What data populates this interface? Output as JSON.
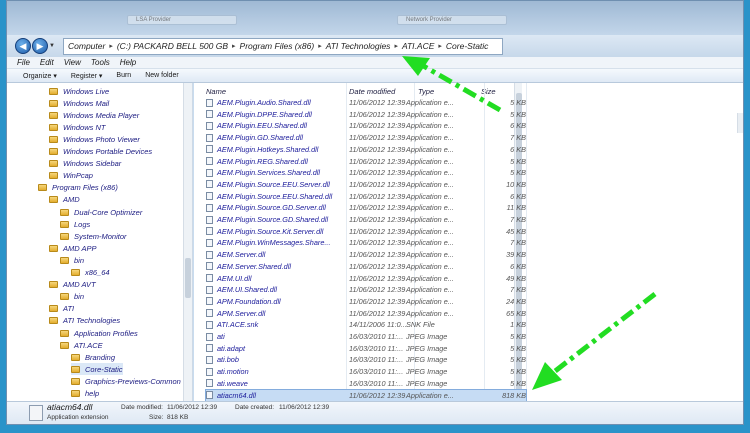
{
  "browser": {
    "tabs": [
      "LSA Provider",
      "Network Provider"
    ]
  },
  "address": {
    "crumbs": [
      "Computer",
      "(C:) PACKARD BELL 500 GB",
      "Program Files (x86)",
      "ATI Technologies",
      "ATI.ACE",
      "Core-Static"
    ]
  },
  "menu": [
    "File",
    "Edit",
    "View",
    "Tools",
    "Help"
  ],
  "toolbar": {
    "organize": "Organize ▾",
    "register": "Register ▾",
    "burn": "Burn",
    "new_folder": "New folder"
  },
  "tree": [
    {
      "label": "Windows Live",
      "indent": 2
    },
    {
      "label": "Windows Mail",
      "indent": 2
    },
    {
      "label": "Windows Media Player",
      "indent": 2
    },
    {
      "label": "Windows NT",
      "indent": 2
    },
    {
      "label": "Windows Photo Viewer",
      "indent": 2
    },
    {
      "label": "Windows Portable Devices",
      "indent": 2
    },
    {
      "label": "Windows Sidebar",
      "indent": 2
    },
    {
      "label": "WinPcap",
      "indent": 2
    },
    {
      "label": "Program Files (x86)",
      "indent": 1
    },
    {
      "label": "AMD",
      "indent": 2
    },
    {
      "label": "Dual-Core Optimizer",
      "indent": 3
    },
    {
      "label": "Logs",
      "indent": 3
    },
    {
      "label": "System-Monitor",
      "indent": 3
    },
    {
      "label": "AMD APP",
      "indent": 2
    },
    {
      "label": "bin",
      "indent": 3
    },
    {
      "label": "x86_64",
      "indent": 4
    },
    {
      "label": "AMD AVT",
      "indent": 2
    },
    {
      "label": "bin",
      "indent": 3
    },
    {
      "label": "ATI",
      "indent": 2
    },
    {
      "label": "ATI Technologies",
      "indent": 2
    },
    {
      "label": "Application Profiles",
      "indent": 3
    },
    {
      "label": "ATI.ACE",
      "indent": 3
    },
    {
      "label": "Branding",
      "indent": 4
    },
    {
      "label": "Core-Static",
      "indent": 4,
      "selected": true
    },
    {
      "label": "Graphics-Previews-Common",
      "indent": 4
    },
    {
      "label": "help",
      "indent": 4
    }
  ],
  "columns": {
    "name": "Name",
    "date": "Date modified",
    "type": "Type",
    "size": "Size"
  },
  "files": [
    {
      "name": "AEM.Plugin.Audio.Shared.dll",
      "date": "11/06/2012 12:39",
      "type": "Application e...",
      "size": "5 KB"
    },
    {
      "name": "AEM.Plugin.DPPE.Shared.dll",
      "date": "11/06/2012 12:39",
      "type": "Application e...",
      "size": "5 KB"
    },
    {
      "name": "AEM.Plugin.EEU.Shared.dll",
      "date": "11/06/2012 12:39",
      "type": "Application e...",
      "size": "6 KB"
    },
    {
      "name": "AEM.Plugin.GD.Shared.dll",
      "date": "11/06/2012 12:39",
      "type": "Application e...",
      "size": "7 KB"
    },
    {
      "name": "AEM.Plugin.Hotkeys.Shared.dll",
      "date": "11/06/2012 12:39",
      "type": "Application e...",
      "size": "6 KB"
    },
    {
      "name": "AEM.Plugin.REG.Shared.dll",
      "date": "11/06/2012 12:39",
      "type": "Application e...",
      "size": "5 KB"
    },
    {
      "name": "AEM.Plugin.Services.Shared.dll",
      "date": "11/06/2012 12:39",
      "type": "Application e...",
      "size": "5 KB"
    },
    {
      "name": "AEM.Plugin.Source.EEU.Server.dll",
      "date": "11/06/2012 12:39",
      "type": "Application e...",
      "size": "10 KB"
    },
    {
      "name": "AEM.Plugin.Source.EEU.Shared.dll",
      "date": "11/06/2012 12:39",
      "type": "Application e...",
      "size": "6 KB"
    },
    {
      "name": "AEM.Plugin.Source.GD.Server.dll",
      "date": "11/06/2012 12:39",
      "type": "Application e...",
      "size": "11 KB"
    },
    {
      "name": "AEM.Plugin.Source.GD.Shared.dll",
      "date": "11/06/2012 12:39",
      "type": "Application e...",
      "size": "7 KB"
    },
    {
      "name": "AEM.Plugin.Source.Kit.Server.dll",
      "date": "11/06/2012 12:39",
      "type": "Application e...",
      "size": "45 KB"
    },
    {
      "name": "AEM.Plugin.WinMessages.Share...",
      "date": "11/06/2012 12:39",
      "type": "Application e...",
      "size": "7 KB"
    },
    {
      "name": "AEM.Server.dll",
      "date": "11/06/2012 12:39",
      "type": "Application e...",
      "size": "39 KB"
    },
    {
      "name": "AEM.Server.Shared.dll",
      "date": "11/06/2012 12:39",
      "type": "Application e...",
      "size": "6 KB"
    },
    {
      "name": "AEM.UI.dll",
      "date": "11/06/2012 12:39",
      "type": "Application e...",
      "size": "49 KB"
    },
    {
      "name": "AEM.UI.Shared.dll",
      "date": "11/06/2012 12:39",
      "type": "Application e...",
      "size": "7 KB"
    },
    {
      "name": "APM.Foundation.dll",
      "date": "11/06/2012 12:39",
      "type": "Application e...",
      "size": "24 KB"
    },
    {
      "name": "APM.Server.dll",
      "date": "11/06/2012 12:39",
      "type": "Application e...",
      "size": "65 KB"
    },
    {
      "name": "ATI.ACE.snk",
      "date": "14/11/2006 11:0...",
      "type": "SNK File",
      "size": "1 KB"
    },
    {
      "name": "ati",
      "date": "16/03/2010 11:...",
      "type": "JPEG Image",
      "size": "5 KB"
    },
    {
      "name": "ati.adapt",
      "date": "16/03/2010 11:...",
      "type": "JPEG Image",
      "size": "5 KB"
    },
    {
      "name": "ati.bob",
      "date": "16/03/2010 11:...",
      "type": "JPEG Image",
      "size": "5 KB"
    },
    {
      "name": "ati.motion",
      "date": "16/03/2010 11:...",
      "type": "JPEG Image",
      "size": "5 KB"
    },
    {
      "name": "ati.weave",
      "date": "16/03/2010 11:...",
      "type": "JPEG Image",
      "size": "5 KB"
    },
    {
      "name": "atiacm64.dll",
      "date": "11/06/2012 12:39",
      "type": "Application e...",
      "size": "818 KB",
      "selected": true
    }
  ],
  "status": {
    "name": "atiacm64.dll",
    "date_modified_label": "Date modified:",
    "date_modified": "11/06/2012 12:39",
    "date_created_label": "Date created:",
    "date_created": "11/06/2012 12:39",
    "type": "Application extension",
    "size_label": "Size:",
    "size": "818 KB"
  },
  "colors": {
    "arrow": "#22dd22",
    "accent": "#2a93c9"
  }
}
